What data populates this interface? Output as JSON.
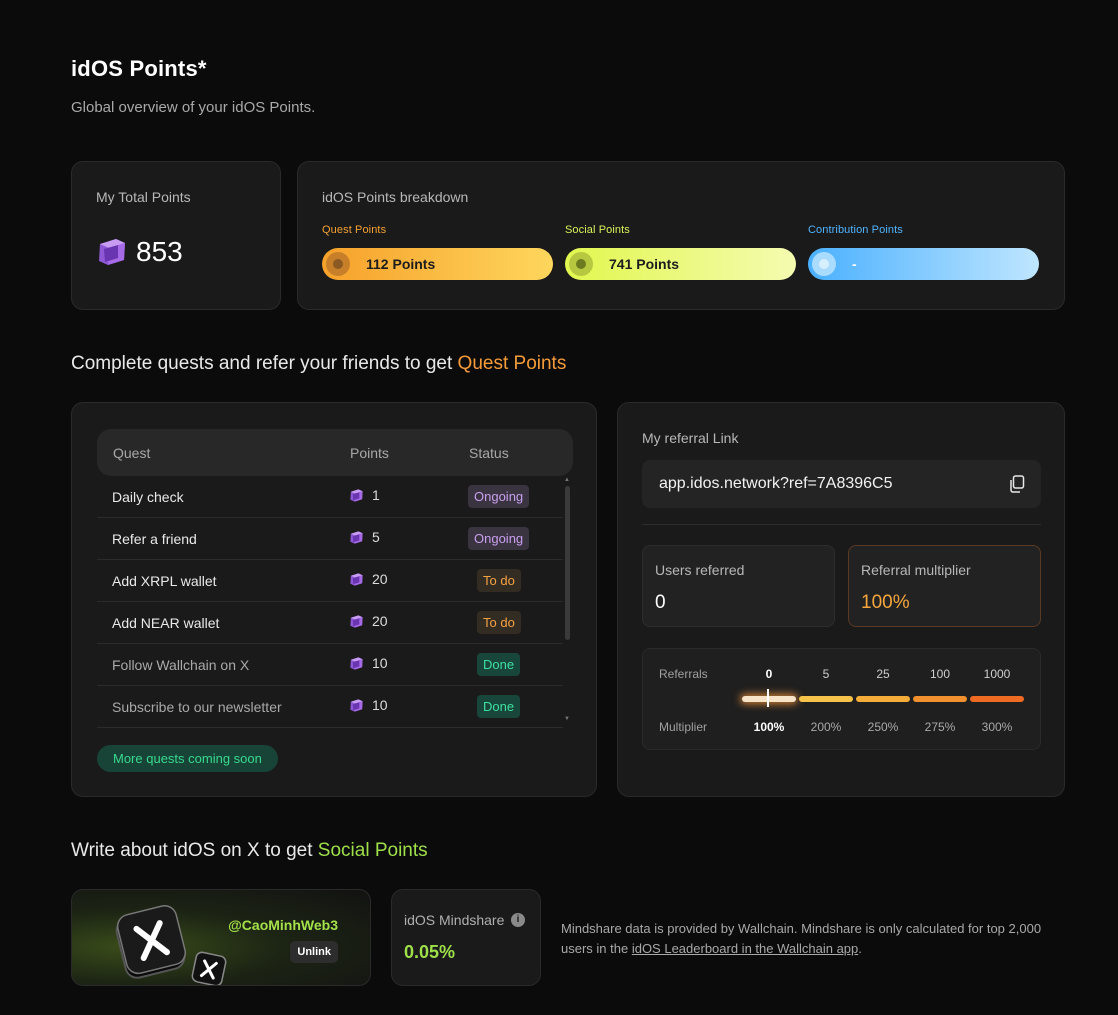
{
  "header": {
    "title": "idOS Points*",
    "subtitle": "Global overview of your idOS Points."
  },
  "total": {
    "label": "My Total Points",
    "value": "853"
  },
  "breakdown": {
    "label": "idOS Points breakdown",
    "quest": {
      "label": "Quest Points",
      "value": "112 Points",
      "color": "#f5a034"
    },
    "social": {
      "label": "Social Points",
      "value": "741 Points",
      "color": "#d9f25a"
    },
    "contribution": {
      "label": "Contribution Points",
      "value": "-",
      "color": "#4fb4ff"
    }
  },
  "quests_section": {
    "title_prefix": "Complete quests and refer your friends to get ",
    "title_accent": "Quest Points"
  },
  "quest_table": {
    "headers": {
      "quest": "Quest",
      "points": "Points",
      "status": "Status"
    },
    "rows": [
      {
        "name": "Daily check",
        "points": "1",
        "status": "Ongoing"
      },
      {
        "name": "Refer a friend",
        "points": "5",
        "status": "Ongoing"
      },
      {
        "name": "Add XRPL wallet",
        "points": "20",
        "status": "To do"
      },
      {
        "name": "Add NEAR wallet",
        "points": "20",
        "status": "To do"
      },
      {
        "name": "Follow Wallchain on X",
        "points": "10",
        "status": "Done"
      },
      {
        "name": "Subscribe to our newsletter",
        "points": "10",
        "status": "Done"
      }
    ],
    "more": "More quests coming soon"
  },
  "referral": {
    "label": "My referral Link",
    "link": "app.idos.network?ref=7A8396C5",
    "users_label": "Users referred",
    "users_value": "0",
    "mult_label": "Referral multiplier",
    "mult_value": "100%",
    "table": {
      "ref_label": "Referrals",
      "mul_label": "Multiplier",
      "tiers": [
        {
          "referrals": "0",
          "multiplier": "100%",
          "color": "#f7e3c8"
        },
        {
          "referrals": "5",
          "multiplier": "200%",
          "color": "#f5c24a"
        },
        {
          "referrals": "25",
          "multiplier": "250%",
          "color": "#f5ac38"
        },
        {
          "referrals": "100",
          "multiplier": "275%",
          "color": "#f2902e"
        },
        {
          "referrals": "1000",
          "multiplier": "300%",
          "color": "#ef6a22"
        }
      ]
    }
  },
  "social_section": {
    "title_prefix": "Write about idOS on X to get ",
    "title_accent": "Social Points"
  },
  "x_account": {
    "handle": "@CaoMinhWeb3",
    "unlink_label": "Unlink"
  },
  "mindshare": {
    "label": "idOS Mindshare",
    "value": "0.05%",
    "note_prefix": "Mindshare data is provided by Wallchain. Mindshare is only calculated for top 2,000 users in the ",
    "note_link": "idOS Leaderboard in the Wallchain app",
    "note_suffix": "."
  }
}
